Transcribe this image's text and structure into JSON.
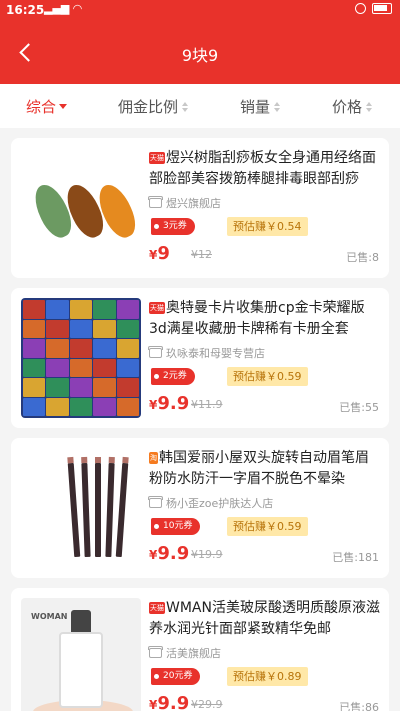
{
  "status_bar": {
    "time": "16:25",
    "icons": [
      "signal-icon",
      "wifi-icon"
    ],
    "right_icons": [
      "alarm-icon",
      "battery-icon"
    ]
  },
  "nav": {
    "title": "9块9"
  },
  "sort": {
    "tabs": [
      "综合",
      "佣金比例",
      "销量",
      "价格"
    ],
    "active": "综合"
  },
  "colors": {
    "accent": "#e8322b",
    "estimate_bg": "#ffe8a8"
  },
  "products": [
    {
      "tag": "天猫",
      "title": "煜兴树脂刮痧板女全身通用经络面部脸部美容拨筋棒腿排毒眼部刮痧",
      "shop": "煜兴旗舰店",
      "coupon": "3元券",
      "estimate": "预估赚￥0.54",
      "price_symbol": "¥",
      "price": "9",
      "original": "¥12",
      "sold": "已售:8"
    },
    {
      "tag": "天猫",
      "title": "奥特曼卡片收集册cp金卡荣耀版3d满星收藏册卡牌稀有卡册全套",
      "shop": "玖咏泰和母婴专营店",
      "coupon": "2元券",
      "estimate": "预估赚￥0.59",
      "price_symbol": "¥",
      "price": "9.9",
      "original": "¥11.9",
      "sold": "已售:55"
    },
    {
      "tag": "淘",
      "title": "韩国爱丽小屋双头旋转自动眉笔眉粉防水防汗一字眉不脱色不晕染",
      "shop": "杨小歪zoe护肤达人店",
      "coupon": "10元券",
      "estimate": "预估赚￥0.59",
      "price_symbol": "¥",
      "price": "9.9",
      "original": "¥19.9",
      "sold": "已售:181"
    },
    {
      "tag": "天猫",
      "title": "WMAN活美玻尿酸透明质酸原液滋养水润光针面部紧致精华免邮",
      "shop": "活美旗舰店",
      "coupon": "20元券",
      "estimate": "预估赚￥0.89",
      "price_symbol": "¥",
      "price": "9.9",
      "original": "¥29.9",
      "sold": "已售:86",
      "image_text": "WOMAN"
    }
  ]
}
